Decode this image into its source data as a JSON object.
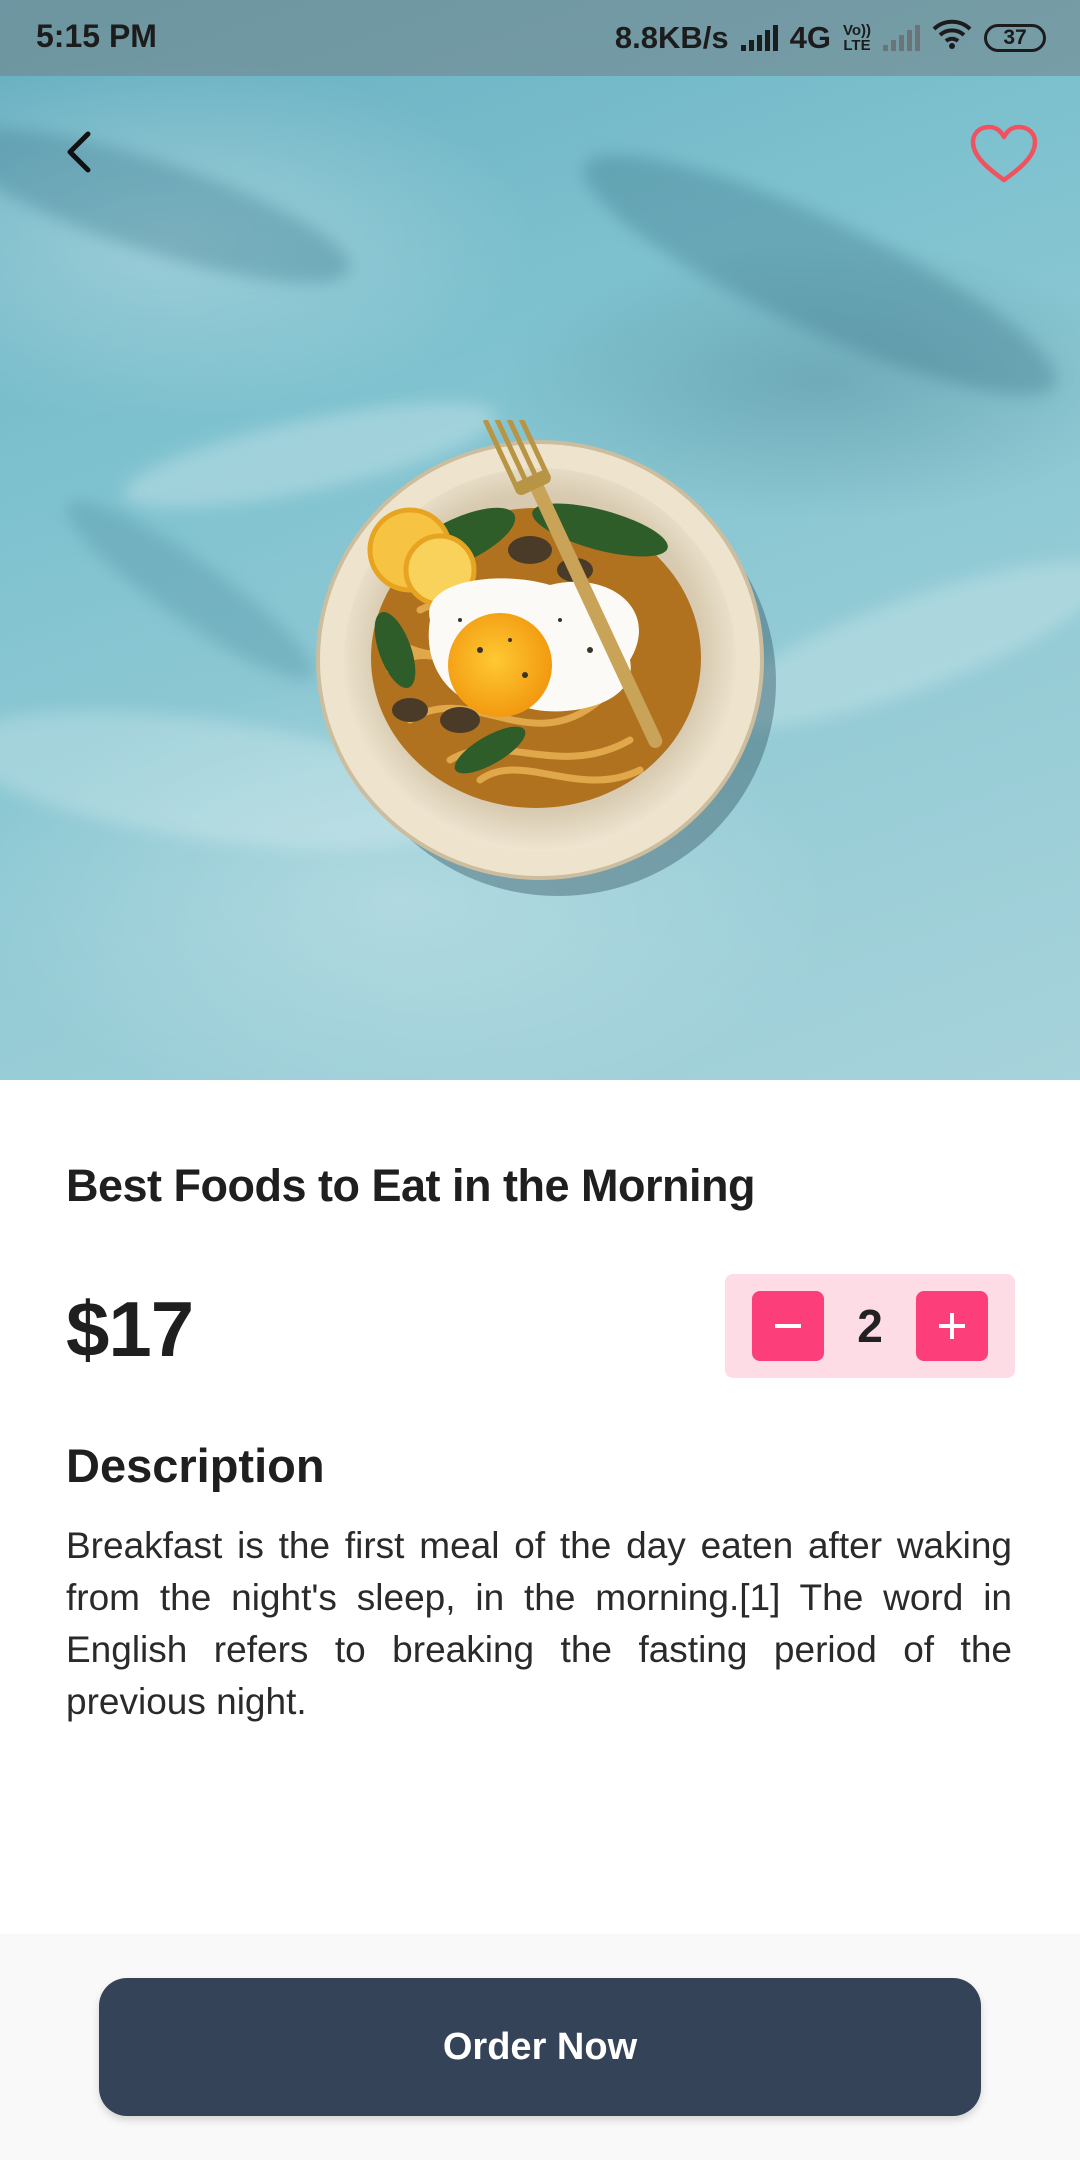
{
  "status_bar": {
    "time": "5:15 PM",
    "network_speed": "8.8KB/s",
    "network_type": "4G",
    "volte_top": "Vo))",
    "volte_bottom": "LTE",
    "battery": "37",
    "icons": [
      "signal-icon",
      "volte-icon",
      "signal-icon-sim2",
      "wifi-icon",
      "battery-icon"
    ]
  },
  "header": {
    "back_icon": "chevron-left-icon",
    "favorite_icon": "heart-outline-icon"
  },
  "product": {
    "title": "Best Foods to Eat in the Morning",
    "price": "$17",
    "quantity": "2",
    "description_heading": "Description",
    "description": "Breakfast is the first meal of the day eaten after waking from the night's sleep, in the morning.[1] The word in English refers to breaking the fasting period of the previous night."
  },
  "actions": {
    "order_label": "Order Now"
  },
  "colors": {
    "accent_pink": "#fc3f7a",
    "stepper_bg": "#fddce6",
    "button_dark": "#344358",
    "heart": "#f0525f"
  }
}
